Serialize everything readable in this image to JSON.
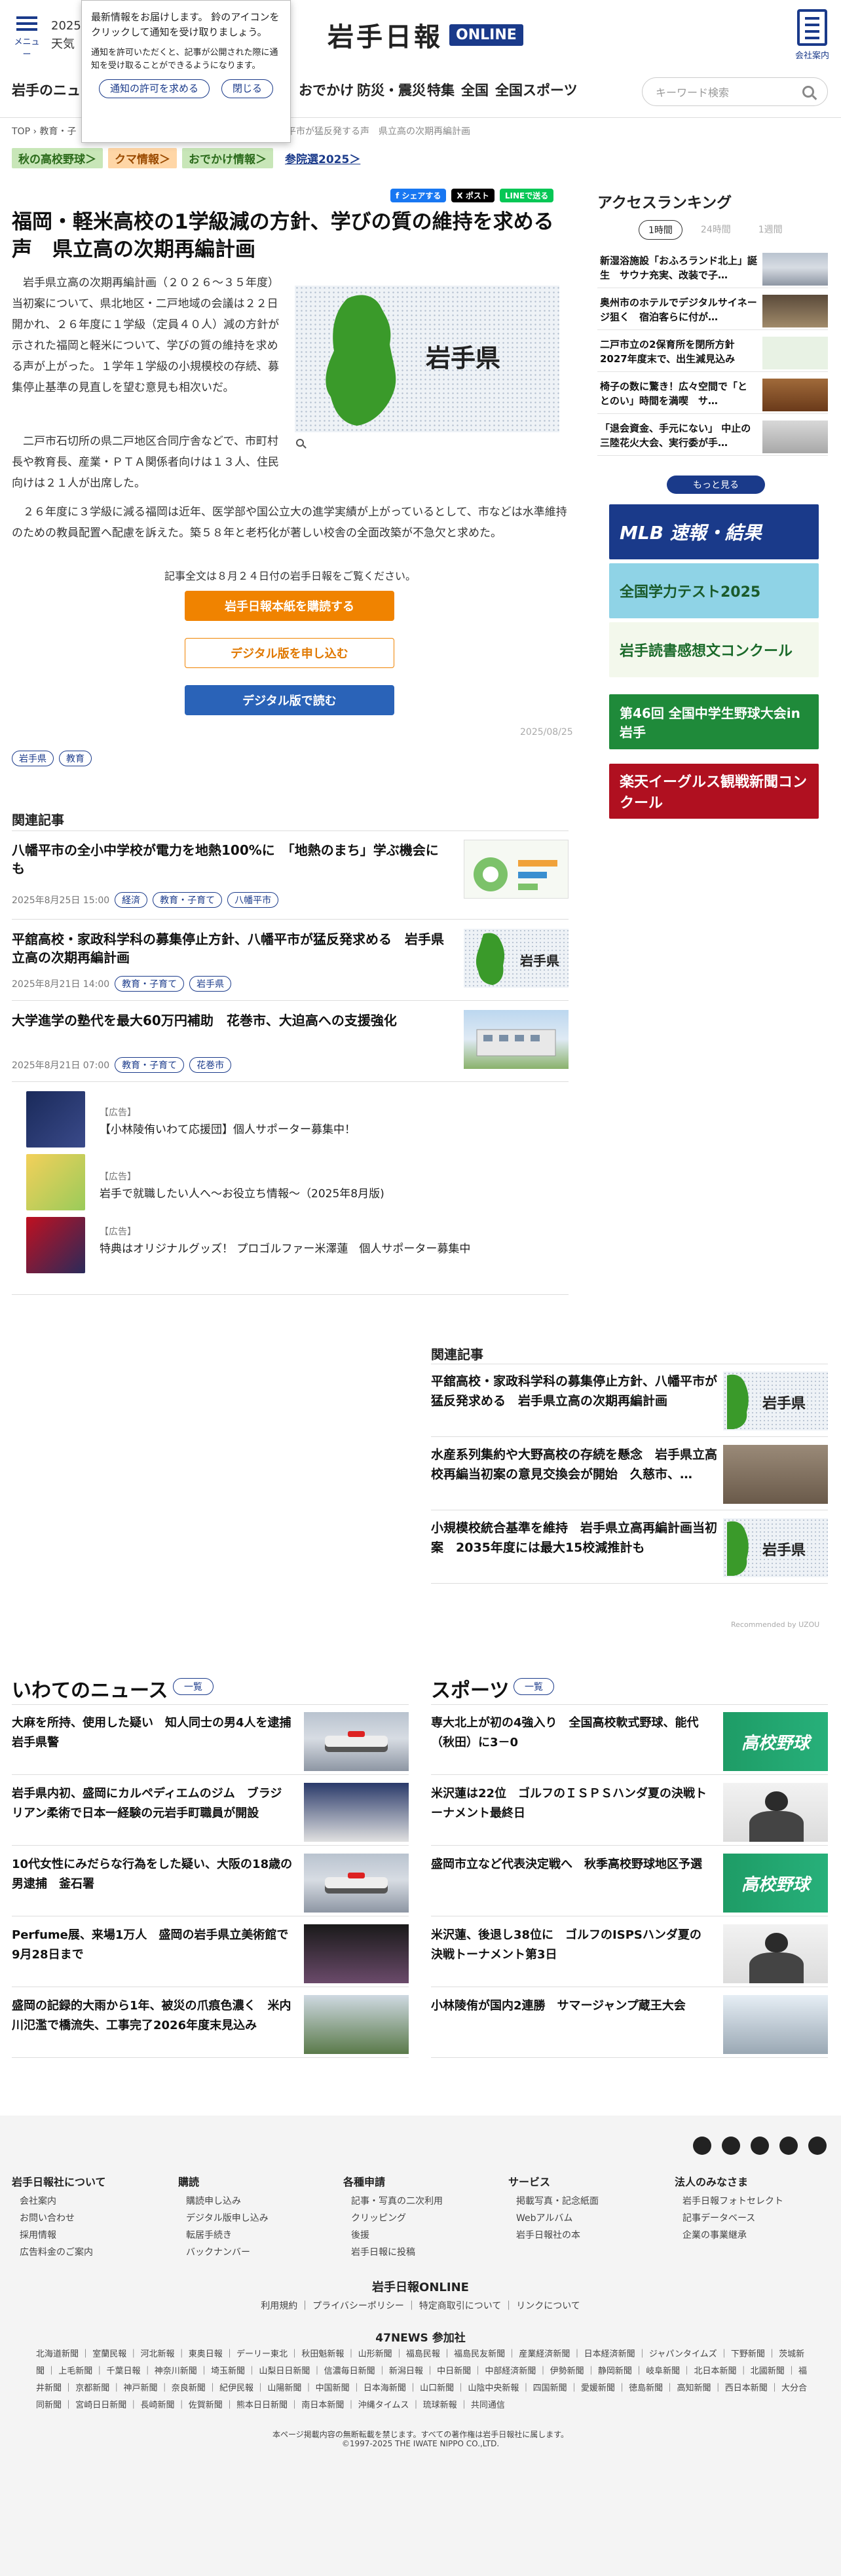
{
  "header": {
    "menu_label": "メニュー",
    "weather_line1": "2025.",
    "weather_line2": "天気",
    "logo_main": "岩手日報",
    "logo_online": "ONLINE",
    "company_label": "会社案内"
  },
  "notify": {
    "text1": "最新情報をお届けします。\n鈴のアイコンをクリックして通知を受け取りましょう。",
    "text2": "通知を許可いただくと、記事が公開された際に通知を受け取ることができるようになります。",
    "allow": "通知の許可を求める",
    "close": "閉じる"
  },
  "nav": {
    "items": [
      "岩手のニュー",
      "おでかけ",
      "防災・震災",
      "特集",
      "全国",
      "全国スポーツ"
    ],
    "search_placeholder": "キーワード検索"
  },
  "breadcrumb": {
    "top": "TOP",
    "sep": "›",
    "cat": "教育・子",
    "rest": "八幡平市が猛反発する声　県立高の次期再編計画"
  },
  "topic_tags": [
    {
      "label": "秋の高校野球＞",
      "bg": "#c8e6b8",
      "fg": "#2a6a1a"
    },
    {
      "label": "クマ情報＞",
      "bg": "#ffd6a6",
      "fg": "#9a4a00"
    },
    {
      "label": "おでかけ情報＞",
      "bg": "#c8e6b8",
      "fg": "#2a6a1a"
    },
    {
      "label": "参院選2025＞",
      "bg": "#fff",
      "fg": "#1a3a8a"
    }
  ],
  "share": {
    "fb": "f シェアする",
    "x": "X ポスト",
    "line": "LINEで送る"
  },
  "article": {
    "title": "福岡・軽米高校の1学級減の方針、学びの質の維持を求める声　県立高の次期再編計画",
    "p1": "岩手県立高の次期再編計画（２０２６～３５年度）当初案について、県北地区・二戸地域の会議は２２日開かれ、２６年度に１学級（定員４０人）減の方針が示された福岡と軽米について、学びの質の維持を求める声が上がった。１学年１学級の小規模校の存続、募集停止基準の見直しを望む意見も相次いだ。",
    "p2": "二戸市石切所の県二戸地区合同庁舎などで、市町村長や教育長、産業・ＰＴＡ関係者向けは１３人、住民向けは２１人が出席した。",
    "p3": "２６年度に３学級に減る福岡は近年、医学部や国公立大の進学実績が上がっているとして、市などは水準維持のための教員配置へ配慮を訴えた。築５８年と老朽化が著しい校舎の全面改築が不急欠と求めた。",
    "image_label": "岩手県",
    "full_text": "記事全文は８月２４日付の岩手日報をご覧ください。",
    "cta_buy": "岩手日報本紙を購読する",
    "cta_digital": "デジタル版を申し込む",
    "cta_read": "デジタル版で読む",
    "date": "2025/08/25",
    "keywords": [
      "岩手県",
      "教育"
    ]
  },
  "related": {
    "title": "関連記事",
    "items": [
      {
        "title": "八幡平市の全小中学校が電力を地熱100%に　「地熱のまち」学ぶ機会にも",
        "date": "2025年8月25日 15:00",
        "tags": [
          "経済",
          "教育・子育て",
          "八幡平市"
        ],
        "thumb": "chart"
      },
      {
        "title": "平舘高校・家政科学科の募集停止方針、八幡平市が猛反発求める　岩手県立高の次期再編計画",
        "date": "2025年8月21日 14:00",
        "tags": [
          "教育・子育て",
          "岩手県"
        ],
        "thumb": "map"
      },
      {
        "title": "大学進学の塾代を最大60万円補助　花巻市、大迫高への支援強化",
        "date": "2025年8月21日 07:00",
        "tags": [
          "教育・子育て",
          "花巻市"
        ],
        "thumb": "school"
      }
    ]
  },
  "ads": [
    {
      "pr": "【広告】",
      "text": "【小林陵侑いわて応援団】個人サポーター募集中！"
    },
    {
      "pr": "【広告】",
      "text": "岩手で就職したい人へ〜お役立ち情報〜（2025年8月版)"
    },
    {
      "pr": "【広告】",
      "text": "特典はオリジナルグッズ！ プロゴルファー米澤蓮　個人サポーター募集中"
    }
  ],
  "ranking": {
    "title": "アクセスランキング",
    "tabs": [
      "1時間",
      "24時間",
      "1週間"
    ],
    "items": [
      "新湿浴施設「おふろランド北上」誕生　サウナ充実、改装で子…",
      "奥州市のホテルでデジタルサイネージ狙く　宿泊客らに付が…",
      "二戸市立の2保育所を閉所方針 2027年度末で、出生減見込み",
      "椅子の数に驚き！広々空間で「ととのい」時間を満喫　サ…",
      "「退会資金、手元にない」 中止の三陸花火大会、実行委が手…"
    ],
    "more": "もっと見る"
  },
  "banners": [
    {
      "text": "MLB 速報・結果",
      "bg": "#1a3a8a",
      "fg": "#fff"
    },
    {
      "text": "全国学力テスト2025",
      "bg": "#8fd3e6",
      "fg": "#1a5a2a"
    },
    {
      "text": "岩手読書感想文コンクール",
      "bg": "#f3f8ec",
      "fg": "#1a6a2a"
    },
    {
      "text": "第46回 全国中学生野球大会in岩手",
      "bg": "#1f8a3a",
      "fg": "#fff"
    },
    {
      "text": "楽天イーグルス観戦新聞コンクール",
      "bg": "#b01020",
      "fg": "#fff"
    }
  ],
  "recommended": {
    "title": "関連記事",
    "items": [
      "平舘高校・家政科学科の募集停止方針、八幡平市が猛反発求める　岩手県立高の次期再編計画",
      "水産系列集約や大野高校の存続を懸念　岩手県立高校再編当初案の意見交換会が開始　久慈市、…",
      "小規模校統合基準を維持　岩手県立高再編計画当初案　2035年度には最大15校減推計も"
    ],
    "credit": "Recommended by UZOU"
  },
  "iwate_news": {
    "title": "いわてのニュース",
    "more": "一覧",
    "items": [
      "大麻を所持、使用した疑い　知人同士の男4人を逮捕　岩手県警",
      "岩手県内初、盛岡にカルペディエムのジム　ブラジリアン柔術で日本一経験の元岩手町職員が開設",
      "10代女性にみだらな行為をした疑い、大阪の18歳の男逮捕　釜石署",
      "Perfume展、来場1万人　盛岡の岩手県立美術館で9月28日まで",
      "盛岡の記録的大雨から1年、被災の爪痕色濃く　米内川氾濫で橋流失、工事完了2026年度末見込み"
    ]
  },
  "sports": {
    "title": "スポーツ",
    "more": "一覧",
    "items": [
      "専大北上が初の4強入り　全国高校軟式野球、能代（秋田）に3－0",
      "米沢蓮は22位　ゴルフのＩＳＰＳハンダ夏の決戦トーナメント最終日",
      "盛岡市立など代表決定戦へ　秋季高校野球地区予選",
      "米沢蓮、後退し38位に　ゴルフのISPSハンダ夏の決戦トーナメント第3日",
      "小林陵侑が国内2連勝　サマージャンプ蔵王大会"
    ],
    "thumb_label": "高校野球"
  },
  "footer": {
    "cols": [
      {
        "h": "岩手日報社について",
        "i": [
          "会社案内",
          "お問い合わせ",
          "採用情報",
          "広告料金のご案内"
        ]
      },
      {
        "h": "購読",
        "i": [
          "購読申し込み",
          "デジタル版申し込み",
          "転居手続き",
          "バックナンバー"
        ]
      },
      {
        "h": "各種申請",
        "i": [
          "記事・写真の二次利用",
          "クリッピング",
          "後援",
          "岩手日報に投稿"
        ]
      },
      {
        "h": "サービス",
        "i": [
          "掲載写真・記念紙面",
          "Webアルバム",
          "岩手日報社の本"
        ]
      },
      {
        "h": "法人のみなさま",
        "i": [
          "岩手日報フォトセレクト",
          "記事データベース",
          "企業の事業継承"
        ]
      }
    ],
    "brand": "岩手日報ONLINE",
    "links": "利用規約 ｜ プライバシーポリシー ｜ 特定商取引について ｜ リンクについて",
    "f47": "47NEWS 参加社",
    "papers": "北海道新聞 ｜ 室蘭民報 ｜ 河北新報 ｜ 東奥日報 ｜ デーリー東北 ｜ 秋田魁新報 ｜ 山形新聞 ｜ 福島民報 ｜ 福島民友新聞 ｜ 産業経済新聞 ｜ 日本経済新聞 ｜ ジャパンタイムズ ｜ 下野新聞 ｜ 茨城新聞 ｜ 上毛新聞 ｜ 千葉日報 ｜ 神奈川新聞 ｜ 埼玉新聞 ｜ 山梨日日新聞 ｜ 信濃毎日新聞 ｜ 新潟日報 ｜ 中日新聞 ｜ 中部経済新聞 ｜ 伊勢新聞 ｜ 静岡新聞 ｜ 岐阜新聞 ｜ 北日本新聞 ｜ 北國新聞 ｜ 福井新聞 ｜ 京都新聞 ｜ 神戸新聞 ｜ 奈良新聞 ｜ 紀伊民報 ｜ 山陽新聞 ｜ 中国新聞 ｜ 日本海新聞 ｜ 山口新聞 ｜ 山陰中央新報 ｜ 四国新聞 ｜ 愛媛新聞 ｜ 徳島新聞 ｜ 高知新聞 ｜ 西日本新聞 ｜ 大分合同新聞 ｜ 宮崎日日新聞 ｜ 長崎新聞 ｜ 佐賀新聞 ｜ 熊本日日新聞 ｜ 南日本新聞 ｜ 沖縄タイムス ｜ 琉球新報 ｜ 共同通信",
    "copy1": "本ページ掲載内容の無断転載を禁じます。すべての著作権は岩手日報社に属します。",
    "copy2": "©1997-2025 THE IWATE NIPPO CO.,LTD."
  }
}
